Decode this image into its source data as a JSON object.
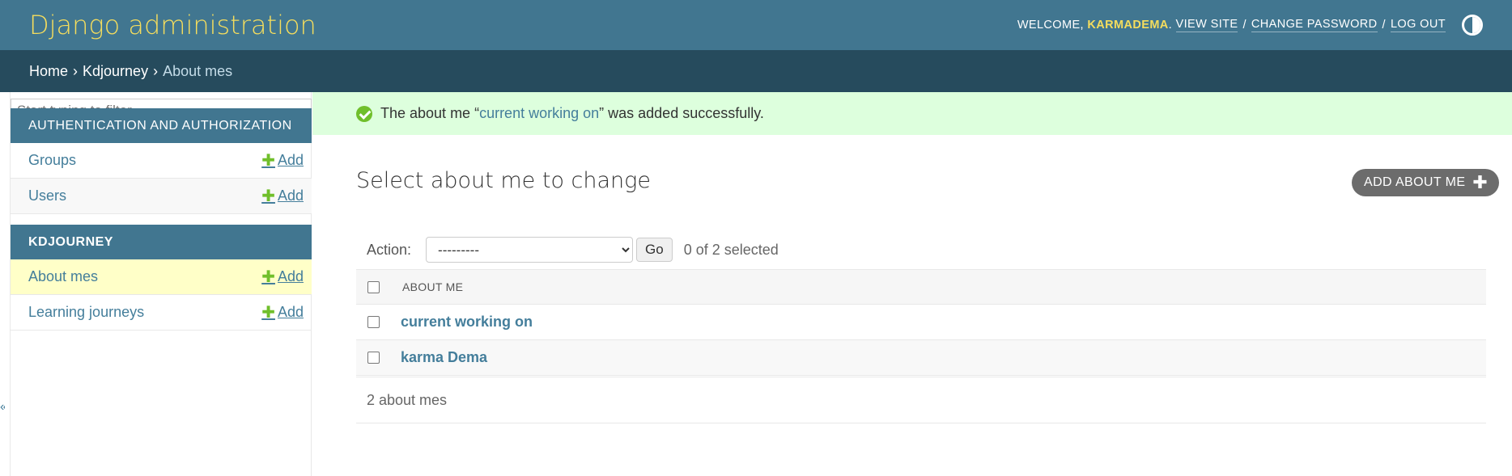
{
  "header": {
    "branding": "Django administration",
    "welcome": "WELCOME,",
    "username": "KARMADEMA",
    "username_suffix": ".",
    "view_site": "VIEW SITE",
    "change_password": "CHANGE PASSWORD",
    "log_out": "LOG OUT",
    "separator": "/",
    "theme_toggle_icon": "half-circle-icon"
  },
  "breadcrumbs": {
    "home": "Home",
    "app": "Kdjourney",
    "current": "About mes",
    "separator": "›"
  },
  "sidebar": {
    "filter_placeholder": "Start typing to filter...",
    "modules": [
      {
        "caption": "Authentication and Authorization",
        "models": [
          {
            "name": "Groups",
            "add": "Add"
          },
          {
            "name": "Users",
            "add": "Add"
          }
        ]
      },
      {
        "caption": "Kdjourney",
        "models": [
          {
            "name": "About mes",
            "add": "Add"
          },
          {
            "name": "Learning journeys",
            "add": "Add"
          }
        ]
      }
    ],
    "collapse_glyph": "«"
  },
  "message": {
    "prefix": "The about me “",
    "link": "current working on",
    "suffix": "” was added successfully."
  },
  "main": {
    "title": "Select about me to change",
    "add_button": "ADD ABOUT ME",
    "action_label": "Action:",
    "action_selected": "---------",
    "go_label": "Go",
    "selected_count": "0 of 2 selected",
    "column_header": "ABOUT ME",
    "rows": [
      "current working on",
      "karma Dema"
    ],
    "paginator": "2 about mes"
  },
  "colors": {
    "header_bg": "#417690",
    "breadcrumbs_bg": "#264b5d",
    "branding": "#f5dd5d",
    "link": "#447e9b",
    "success_bg": "#ddffdd",
    "add_icon": "#70bf2b"
  }
}
